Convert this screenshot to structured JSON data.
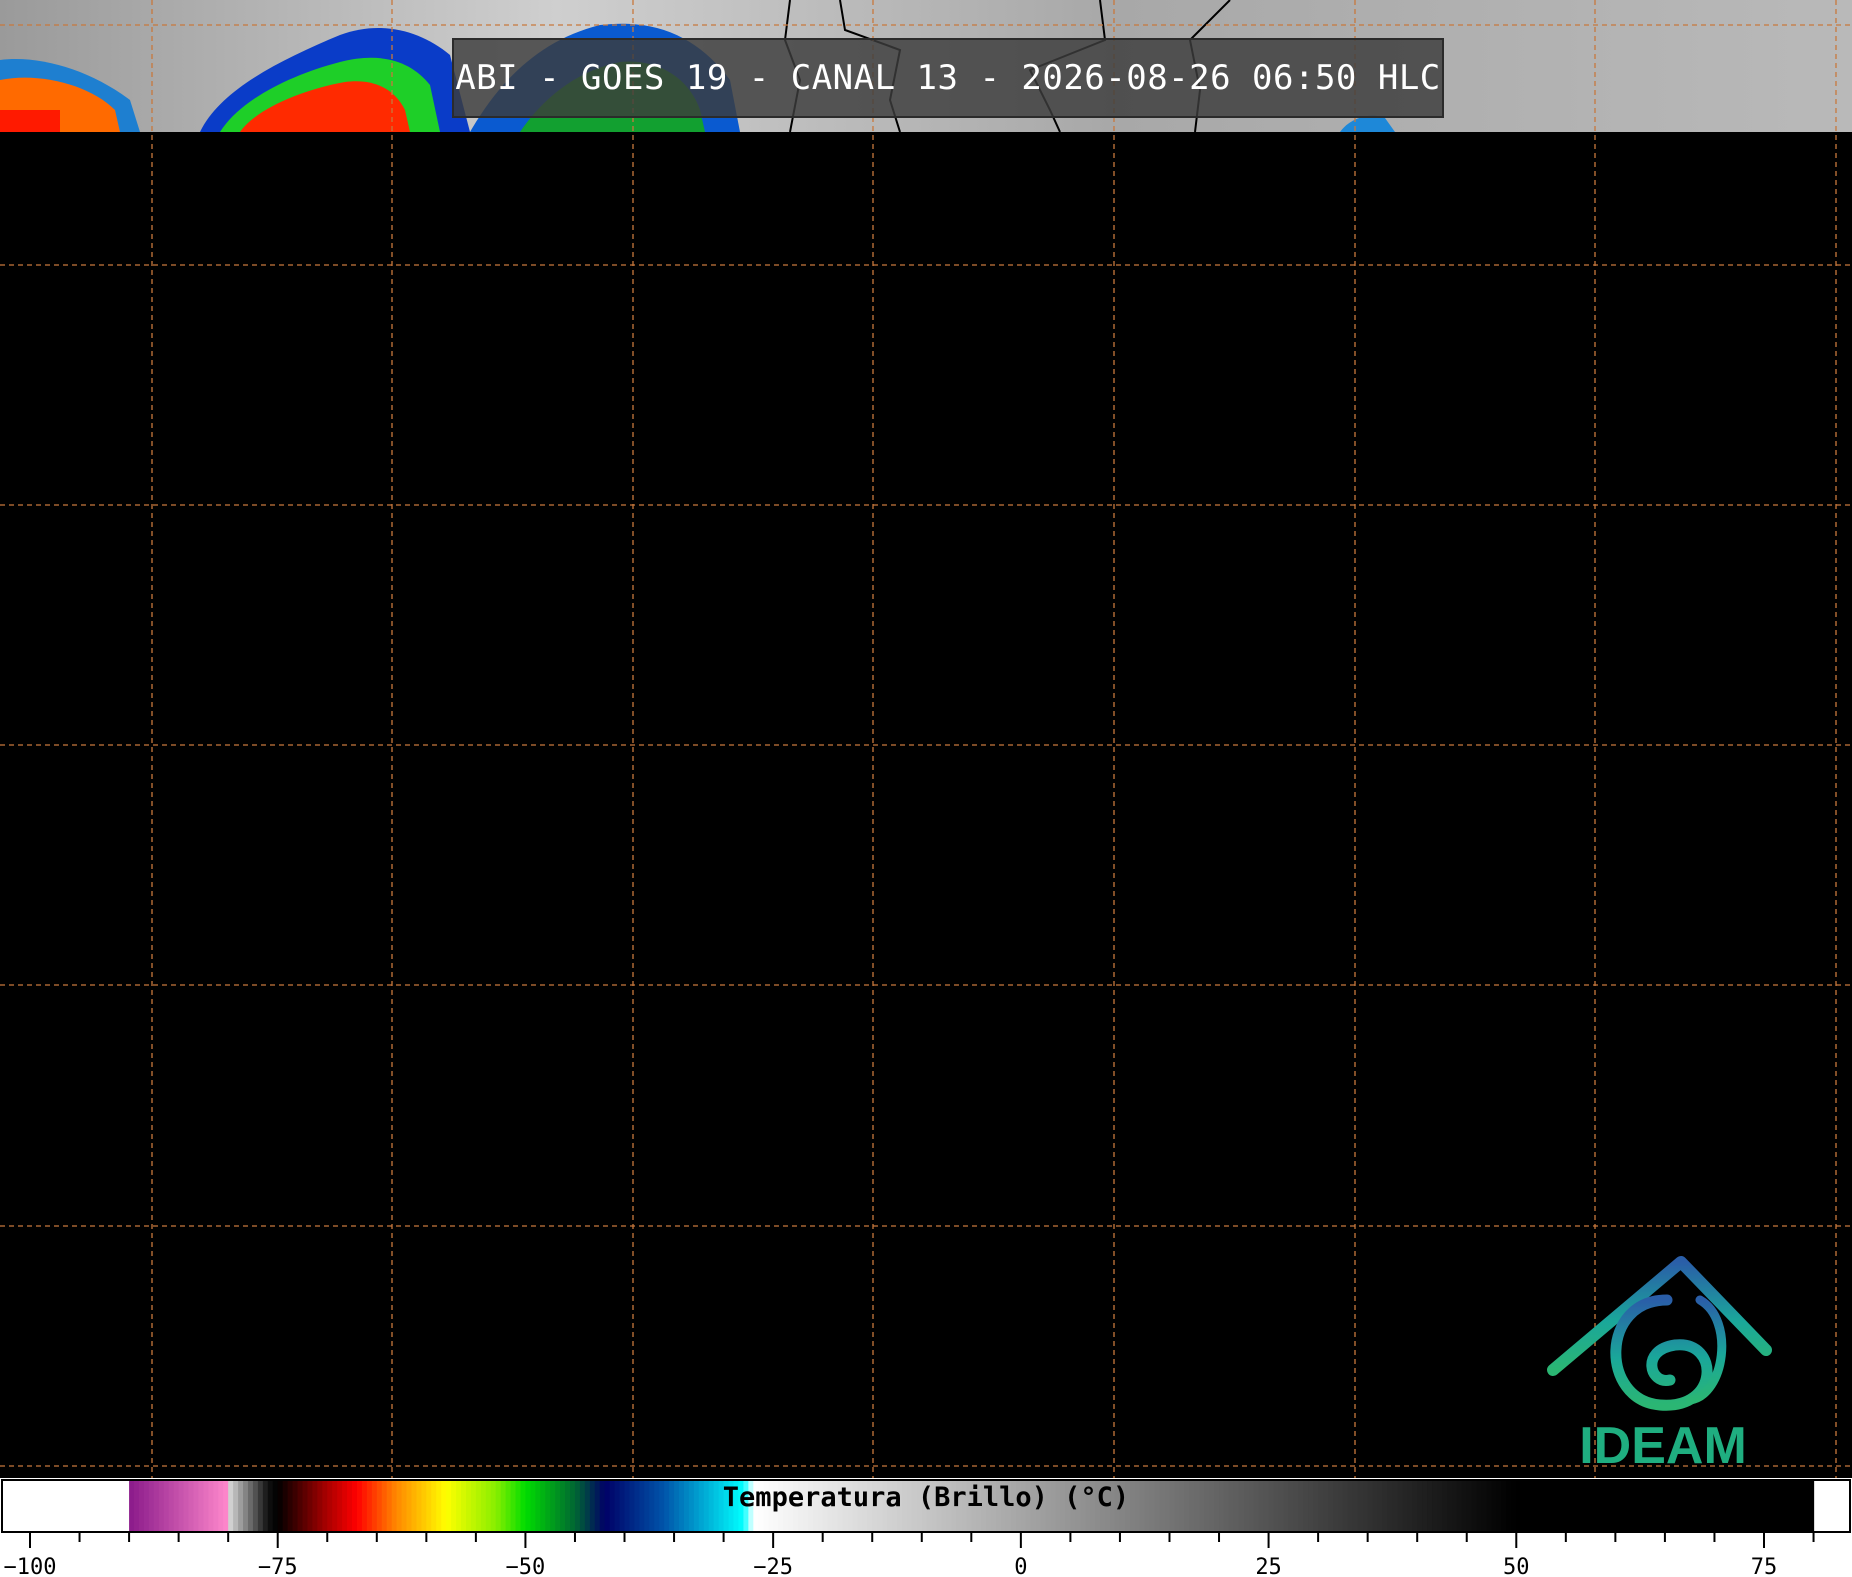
{
  "title": "ABI - GOES 19 - CANAL 13 - 2026-08-26 06:50 HLC",
  "colorbar": {
    "label": "Temperatura (Brillo) (°C)",
    "min": -105,
    "max": 80,
    "ticks": [
      {
        "value": -100,
        "label": "−100"
      },
      {
        "value": -75,
        "label": "−75"
      },
      {
        "value": -50,
        "label": "−50"
      },
      {
        "value": -25,
        "label": "−25"
      },
      {
        "value": 0,
        "label": "0"
      },
      {
        "value": 25,
        "label": "25"
      },
      {
        "value": 50,
        "label": "50"
      },
      {
        "value": 75,
        "label": "75"
      }
    ],
    "minor_tick_step": 5,
    "colors": {
      "coldest": "#ffffff",
      "purple": "#8a1a8a",
      "pink": "#ff88cc",
      "red": "#ff0000",
      "orange": "#ff8800",
      "yellow": "#ffff00",
      "green": "#00dd00",
      "navy": "#000066",
      "blue": "#0055aa",
      "cyan": "#00ffff",
      "black": "#000000"
    }
  },
  "map": {
    "background": "#000000",
    "gridline_color": "#c8783c"
  },
  "logo": {
    "text": "IDEAM",
    "colors": {
      "blue": "#2a5ea8",
      "teal": "#1aa79a",
      "green": "#2bb673"
    }
  }
}
